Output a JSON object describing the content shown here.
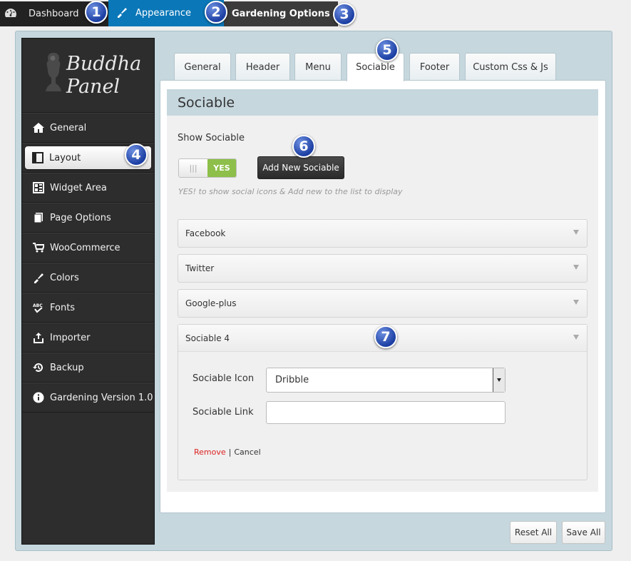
{
  "adminbar": {
    "dashboard": "Dashboard",
    "appearance": "Appearance",
    "gardening_options": "Gardening Options"
  },
  "callouts": [
    "1",
    "2",
    "3",
    "4",
    "5",
    "6",
    "7"
  ],
  "logo": {
    "line1": "Buddha",
    "line2": "Panel"
  },
  "sidebar": {
    "items": [
      {
        "label": "General",
        "icon": "home-icon"
      },
      {
        "label": "Layout",
        "icon": "layout-icon"
      },
      {
        "label": "Widget Area",
        "icon": "widget-icon"
      },
      {
        "label": "Page Options",
        "icon": "pages-icon"
      },
      {
        "label": "WooCommerce",
        "icon": "cart-icon"
      },
      {
        "label": "Colors",
        "icon": "brush-icon"
      },
      {
        "label": "Fonts",
        "icon": "fonts-icon"
      },
      {
        "label": "Importer",
        "icon": "upload-icon"
      },
      {
        "label": "Backup",
        "icon": "history-icon"
      },
      {
        "label": "Gardening Version 1.0",
        "icon": "info-icon"
      }
    ],
    "active": "Layout"
  },
  "tabs": [
    {
      "label": "General"
    },
    {
      "label": "Header"
    },
    {
      "label": "Menu"
    },
    {
      "label": "Sociable"
    },
    {
      "label": "Footer"
    },
    {
      "label": "Custom Css & Js"
    }
  ],
  "active_tab": "Sociable",
  "section": {
    "title": "Sociable",
    "show_label": "Show Sociable",
    "toggle_on_text": "YES",
    "toggle_off_glyph": "|||",
    "add_button": "Add New Sociable",
    "hint": "YES! to show social icons & Add new to the list to display",
    "accordions": [
      {
        "label": "Facebook"
      },
      {
        "label": "Twitter"
      },
      {
        "label": "Google-plus"
      },
      {
        "label": "Sociable 4"
      }
    ],
    "icon_label": "Sociable Icon",
    "icon_value": "Dribble",
    "link_label": "Sociable Link",
    "link_value": "",
    "remove": "Remove",
    "separator": "|",
    "cancel": "Cancel"
  },
  "footer": {
    "reset_all": "Reset All",
    "save_all": "Save All"
  },
  "colors": {
    "accent": "#0a77b8",
    "toggle_on": "#8dbf4a",
    "remove": "#d22222",
    "panel": "#c6d7de"
  }
}
